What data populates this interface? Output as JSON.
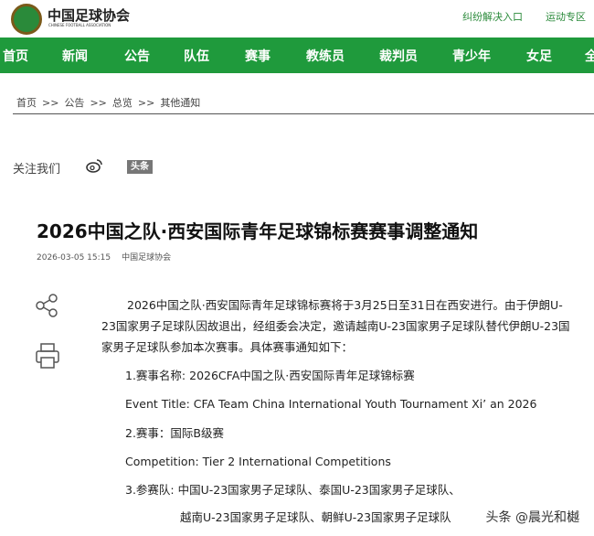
{
  "header": {
    "logo_cn": "中国足球协会",
    "logo_en": "CHINESE FOOTBALL ASSOCIATION",
    "links": [
      "纠纷解决入口",
      "运动专区"
    ]
  },
  "nav": [
    "首页",
    "新闻",
    "公告",
    "队伍",
    "赛事",
    "教练员",
    "裁判员",
    "青少年",
    "女足",
    "全"
  ],
  "breadcrumb": [
    "首页",
    ">>",
    "公告",
    ">>",
    "总览",
    ">>",
    "其他通知"
  ],
  "follow": {
    "label": "关注我们",
    "toutiao": "头条"
  },
  "article": {
    "title": "2026中国之队·西安国际青年足球锦标赛赛事调整通知",
    "date": "2026-03-05 15:15",
    "source": "中国足球协会",
    "intro": "2026中国之队·西安国际青年足球锦标赛将于3月25日至31日在西安进行。由于伊朗U-23国家男子足球队因故退出，经组委会决定，邀请越南U-23国家男子足球队替代伊朗U-23国家男子足球队参加本次赛事。具体赛事通知如下：",
    "items": [
      "1.赛事名称: 2026CFA中国之队·西安国际青年足球锦标赛",
      "Event Title: CFA Team China International Youth Tournament Xi’ an 2026",
      "2.赛事：国际B级赛",
      "Competition: Tier 2 International Competitions",
      "3.参赛队: 中国U-23国家男子足球队、泰国U-23国家男子足球队、",
      "越南U-23国家男子足球队、朝鲜U-23国家男子足球队"
    ]
  },
  "watermark": "头条 @晨光和樾"
}
